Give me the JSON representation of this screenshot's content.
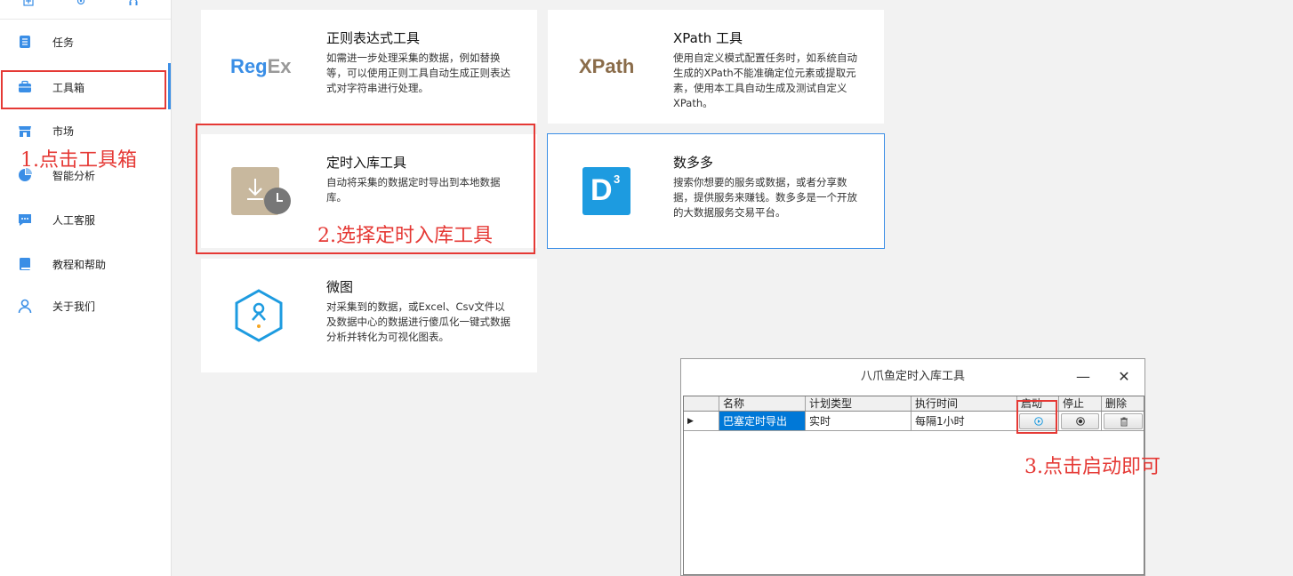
{
  "sidebar": {
    "items": [
      {
        "label": "任务",
        "icon": "clipboard-icon"
      },
      {
        "label": "工具箱",
        "icon": "toolbox-icon"
      },
      {
        "label": "市场",
        "icon": "store-icon"
      },
      {
        "label": "智能分析",
        "icon": "pie-chart-icon"
      },
      {
        "label": "人工客服",
        "icon": "chat-icon"
      },
      {
        "label": "教程和帮助",
        "icon": "book-icon"
      },
      {
        "label": "关于我们",
        "icon": "user-icon"
      }
    ],
    "active_index": 1
  },
  "annotations": {
    "step1": "1.点击工具箱",
    "step2": "2.选择定时入库工具",
    "step3": "3.点击启动即可"
  },
  "cards": {
    "regex": {
      "title": "正则表达式工具",
      "desc": "如需进一步处理采集的数据，例如替换等，可以使用正则工具自动生成正则表达式对字符串进行处理。",
      "logo_a": "Reg",
      "logo_b": "Ex"
    },
    "xpath": {
      "title": "XPath 工具",
      "desc": "使用自定义模式配置任务时，如系统自动生成的XPath不能准确定位元素或提取元素，使用本工具自动生成及测试自定义XPath。",
      "logo": "XPath"
    },
    "scheduler": {
      "title": "定时入库工具",
      "desc": "自动将采集的数据定时导出到本地数据库。"
    },
    "duoduo": {
      "title": "数多多",
      "desc": "搜索你想要的服务或数据，或者分享数据，提供服务来赚钱。数多多是一个开放的大数据服务交易平台。",
      "logo": "D",
      "logo_sup": "3"
    },
    "weitu": {
      "title": "微图",
      "desc": "对采集到的数据，或Excel、Csv文件以及数据中心的数据进行傻瓜化一键式数据分析并转化为可视化图表。"
    }
  },
  "dialog": {
    "title": "八爪鱼定时入库工具",
    "minimize": "—",
    "close": "✕",
    "columns": [
      "名称",
      "计划类型",
      "执行时间",
      "启动",
      "停止",
      "删除"
    ],
    "rows": [
      {
        "name": "巴塞定时导出",
        "plan": "实时",
        "time": "每隔1小时"
      }
    ]
  },
  "colors": {
    "accent": "#3a8ee6",
    "annotation": "#e53935",
    "selection": "#0078d7"
  }
}
